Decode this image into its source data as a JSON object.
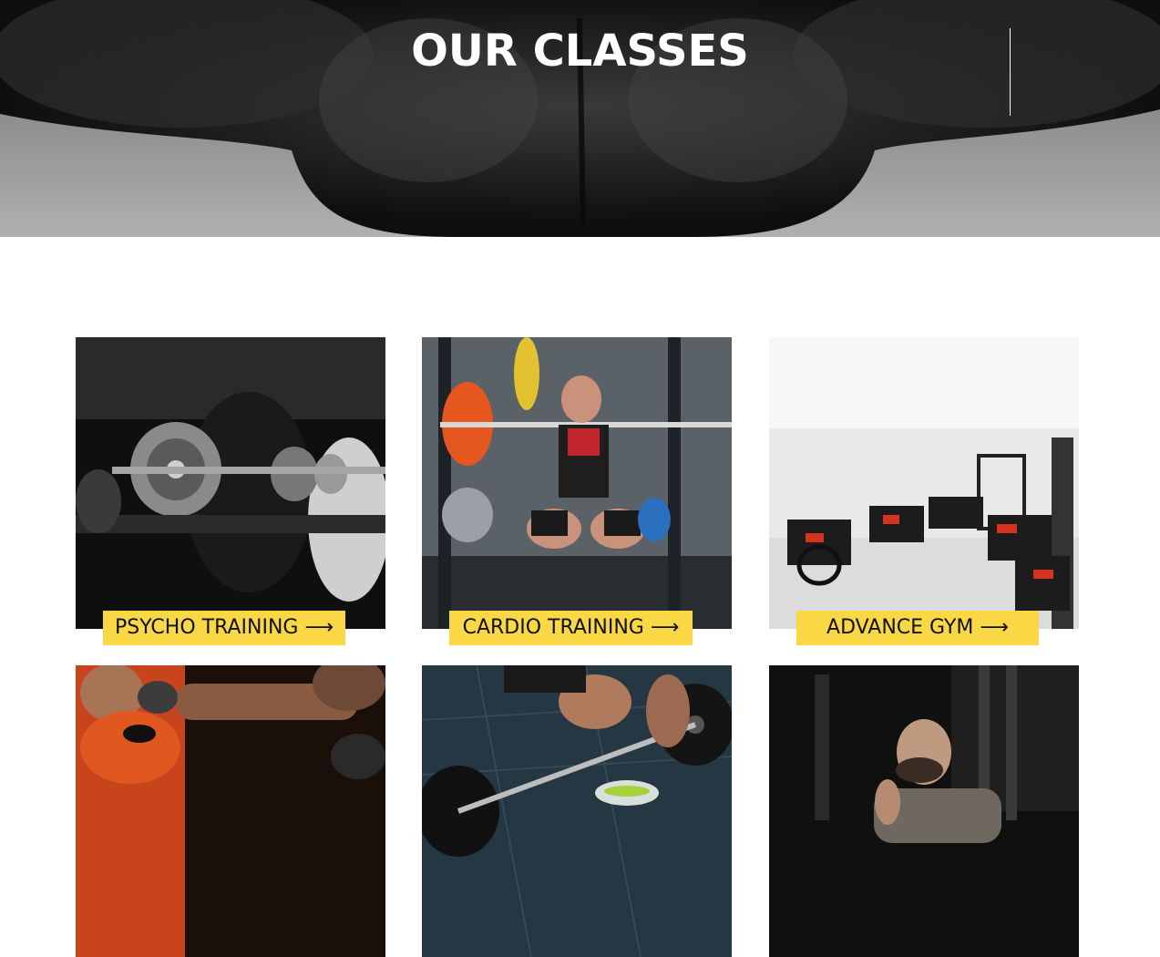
{
  "hero": {
    "title": "OUR CLASSES"
  },
  "classes": [
    {
      "label": "PSYCHO TRAINING",
      "arrow": "⟶",
      "photo": "barbell-squat-black-white-photo"
    },
    {
      "label": "CARDIO TRAINING",
      "arrow": "⟶",
      "photo": "powerlifter-squat-rack-photo"
    },
    {
      "label": "ADVANCE GYM",
      "arrow": "⟶",
      "photo": "gym-floor-equipment-photo"
    },
    {
      "label": "",
      "arrow": "",
      "photo": "boxing-sparring-photo"
    },
    {
      "label": "",
      "arrow": "",
      "photo": "deadlift-barbell-photo"
    },
    {
      "label": "",
      "arrow": "",
      "photo": "bald-man-gym-photo"
    }
  ],
  "colors": {
    "accent": "#f9d745",
    "label_text": "#111111",
    "hero_text": "#ffffff"
  }
}
